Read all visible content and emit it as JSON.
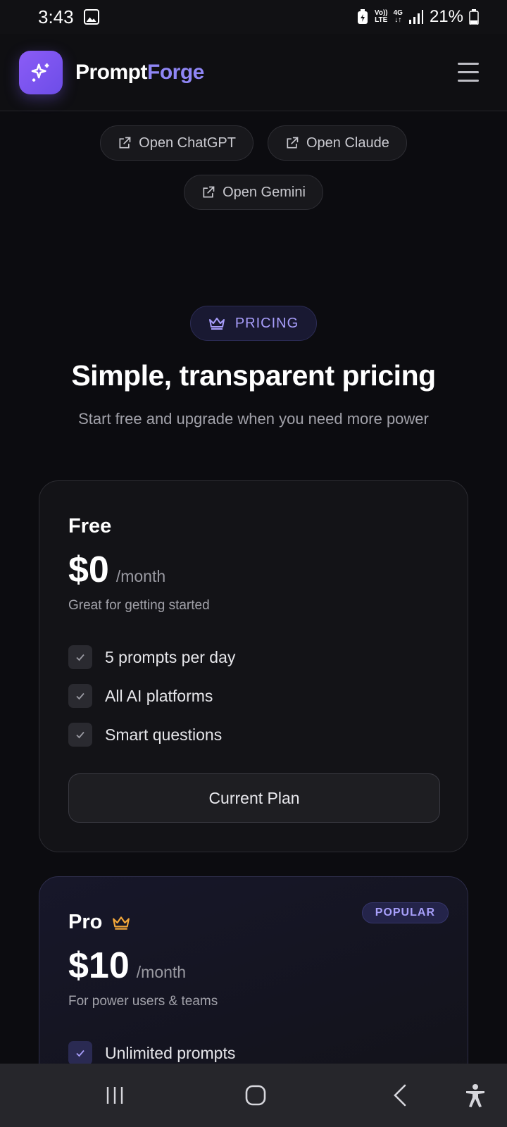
{
  "status_bar": {
    "time": "3:43",
    "network_top": "Vo))",
    "network_bottom": "LTE",
    "data_type": "4G",
    "battery": "21%"
  },
  "header": {
    "brand_part1": "Prompt",
    "brand_part2": "Forge",
    "menu_icon": "hamburger-icon",
    "logo_icon": "sparkles-icon"
  },
  "ai_links": [
    {
      "label": "Open ChatGPT",
      "icon": "external-link-icon"
    },
    {
      "label": "Open Claude",
      "icon": "external-link-icon"
    },
    {
      "label": "Open Gemini",
      "icon": "external-link-icon"
    }
  ],
  "pricing": {
    "badge": "PRICING",
    "badge_icon": "crown-icon",
    "title": "Simple, transparent pricing",
    "subtitle": "Start free and upgrade when you need more power"
  },
  "plans": [
    {
      "name": "Free",
      "price": "$0",
      "period": "/month",
      "description": "Great for getting started",
      "features": [
        "5 prompts per day",
        "All AI platforms",
        "Smart questions"
      ],
      "button": "Current Plan"
    },
    {
      "name": "Pro",
      "badge": "POPULAR",
      "price": "$10",
      "period": "/month",
      "description": "For power users & teams",
      "features": [
        "Unlimited prompts"
      ]
    }
  ],
  "nav_bar": {
    "recents": "recents-icon",
    "home": "home-icon",
    "back": "back-icon",
    "accessibility": "accessibility-icon"
  },
  "colors": {
    "background": "#0c0c10",
    "accent": "#8f86f5",
    "crown_gold": "#f4a83a"
  }
}
